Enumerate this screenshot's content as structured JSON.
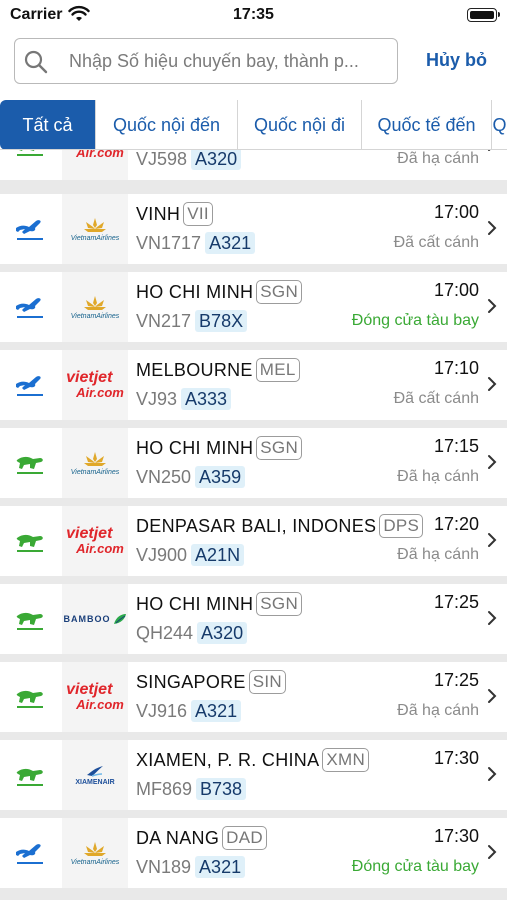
{
  "status_bar": {
    "carrier": "Carrier",
    "time": "17:35"
  },
  "search": {
    "placeholder": "Nhập Số hiệu chuyến bay, thành p...",
    "cancel_label": "Hủy bỏ"
  },
  "tabs": [
    {
      "label": "Tất cả",
      "active": true
    },
    {
      "label": "Quốc nội đến"
    },
    {
      "label": "Quốc nội đi"
    },
    {
      "label": "Quốc tế đến"
    },
    {
      "label": "Q"
    }
  ],
  "flights": [
    {
      "direction": "arrival",
      "airline": "vietjet",
      "city": "",
      "code": "",
      "flight_no": "VJ598",
      "aircraft": "A320",
      "time": "",
      "status": "Đã hạ cánh",
      "status_color": "gray"
    },
    {
      "direction": "departure",
      "airline": "vietnamairlines",
      "airline_text": "VietnamAirlines",
      "city": "VINH",
      "code": "VII",
      "flight_no": "VN1717",
      "aircraft": "A321",
      "time": "17:00",
      "status": "Đã cất cánh",
      "status_color": "gray"
    },
    {
      "direction": "departure",
      "airline": "vietnamairlines",
      "airline_text": "VietnamAirlines",
      "city": "HO CHI MINH",
      "code": "SGN",
      "flight_no": "VN217",
      "aircraft": "B78X",
      "time": "17:00",
      "status": "Đóng cửa tàu bay",
      "status_color": "green"
    },
    {
      "direction": "departure",
      "airline": "vietjet",
      "city": "MELBOURNE",
      "code": "MEL",
      "flight_no": "VJ93",
      "aircraft": "A333",
      "time": "17:10",
      "status": "Đã cất cánh",
      "status_color": "gray"
    },
    {
      "direction": "arrival",
      "airline": "vietnamairlines",
      "airline_text": "VietnamAirlines",
      "city": "HO CHI MINH",
      "code": "SGN",
      "flight_no": "VN250",
      "aircraft": "A359",
      "time": "17:15",
      "status": "Đã hạ cánh",
      "status_color": "gray"
    },
    {
      "direction": "arrival",
      "airline": "vietjet",
      "city": "DENPASAR BALI, INDONES",
      "code": "DPS",
      "flight_no": "VJ900",
      "aircraft": "A21N",
      "time": "17:20",
      "status": "Đã hạ cánh",
      "status_color": "gray"
    },
    {
      "direction": "arrival",
      "airline": "bamboo",
      "airline_text": "BAMBOO",
      "city": "HO CHI MINH",
      "code": "SGN",
      "flight_no": "QH244",
      "aircraft": "A320",
      "time": "17:25",
      "status": "",
      "status_color": "gray"
    },
    {
      "direction": "arrival",
      "airline": "vietjet",
      "city": "SINGAPORE",
      "code": "SIN",
      "flight_no": "VJ916",
      "aircraft": "A321",
      "time": "17:25",
      "status": "Đã hạ cánh",
      "status_color": "gray"
    },
    {
      "direction": "arrival",
      "airline": "xiamen",
      "airline_text": "XIAMENAIR",
      "city": "XIAMEN, P. R. CHINA",
      "code": "XMN",
      "flight_no": "MF869",
      "aircraft": "B738",
      "time": "17:30",
      "status": "",
      "status_color": "gray"
    },
    {
      "direction": "departure",
      "airline": "vietnamairlines",
      "airline_text": "VietnamAirlines",
      "city": "DA NANG",
      "code": "DAD",
      "flight_no": "VN189",
      "aircraft": "A321",
      "time": "17:30",
      "status": "Đóng cửa tàu bay",
      "status_color": "green"
    }
  ],
  "colors": {
    "accent": "#1b5cab",
    "arrival_icon": "#3aa935",
    "departure_icon": "#1b6fd1",
    "status_green": "#3aa935"
  },
  "logo_text": {
    "vietjet_a": "vietjet",
    "vietjet_b": "Air.com"
  }
}
